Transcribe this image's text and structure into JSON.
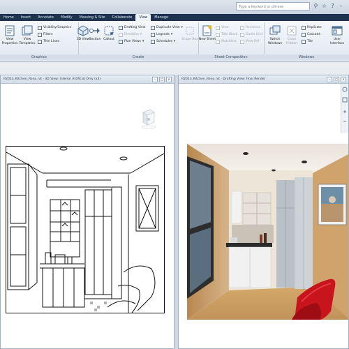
{
  "search": {
    "placeholder": "Type a keyword or phrase"
  },
  "tabs": [
    {
      "label": "Home",
      "active": false
    },
    {
      "label": "Insert",
      "active": false
    },
    {
      "label": "Annotate",
      "active": false
    },
    {
      "label": "Modify",
      "active": false
    },
    {
      "label": "Massing & Site",
      "active": false
    },
    {
      "label": "Collaborate",
      "active": false
    },
    {
      "label": "View",
      "active": true
    },
    {
      "label": "Manage",
      "active": false
    }
  ],
  "ribbon": {
    "graphics": {
      "label": "Graphics",
      "view_properties": "View Properties",
      "view_templates": "View Templates",
      "visibility_graphics": "Visibility/Graphics",
      "filters": "Filters",
      "thin_lines": "Thin Lines"
    },
    "create": {
      "label": "Create",
      "view_3d": "3D View",
      "section": "Section",
      "callout": "Callout",
      "drafting_view": "Drafting View",
      "elevation": "Elevation",
      "plan_views": "Plan Views",
      "duplicate_view": "Duplicate View",
      "legends": "Legends",
      "schedules": "Schedules",
      "scope_box": "Scope Box"
    },
    "sheet": {
      "label": "Sheet Composition",
      "new_sheet": "New Sheet",
      "view": "View",
      "title_block": "Title Block",
      "matchline": "Matchline",
      "revisions": "Revisions",
      "guide_grid": "Guide Grid",
      "view_ref": "View Ref"
    },
    "windows": {
      "label": "Windows",
      "switch_windows": "Switch Windows",
      "close_hidden": "Close Hidden",
      "replicate": "Replicate",
      "cascade": "Cascade",
      "tile": "Tile",
      "user_interface": "User Interface"
    }
  },
  "windows": {
    "left_title": "R2013_Kitchen_Reno.rvt - 3D View: Interior Artificial Only (x3)",
    "right_title": "R2013_Kitchen_Reno.rvt - Drafting View: Final Render"
  },
  "colors": {
    "tab_bar": "#1f3350",
    "ribbon_top": "#f5f8fb",
    "wall_render": "#c89a62",
    "chair": "#c8141c"
  }
}
